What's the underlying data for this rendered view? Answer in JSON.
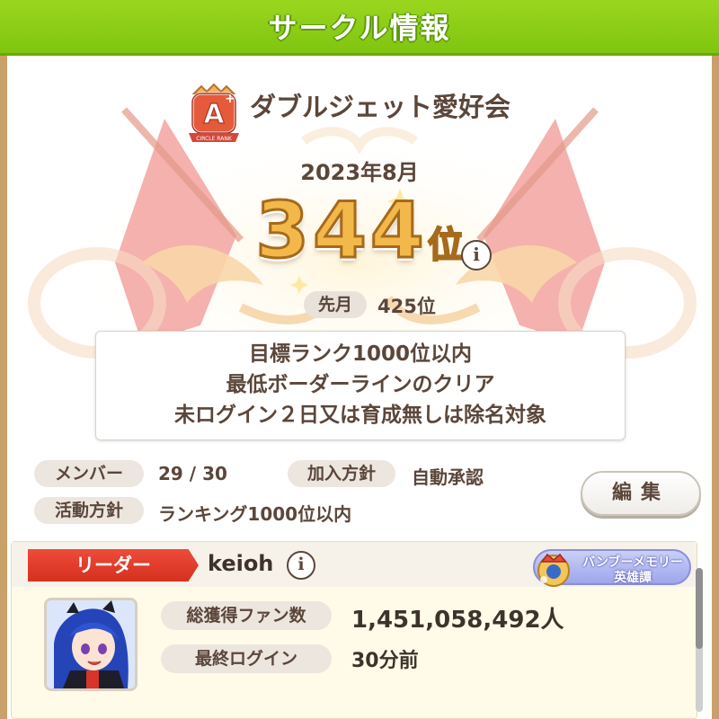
{
  "header": {
    "title": "サークル情報"
  },
  "circle": {
    "rank_badge_letter": "A",
    "rank_badge_text": "CIRCLE RANK",
    "name": "ダブルジェット愛好会",
    "period": "2023年8月",
    "rank_number": "344",
    "rank_unit": "位",
    "last_month_label": "先月",
    "last_month_value": "425位"
  },
  "goal": {
    "lines": [
      "目標ランク1000位以内",
      "最低ボーダーラインのクリア",
      "未ログイン２日又は育成無しは除名対象"
    ]
  },
  "info": {
    "members_label": "メンバー",
    "members_value": "29 / 30",
    "join_policy_label": "加入方針",
    "join_policy_value": "自動承認",
    "activity_label": "活動方針",
    "activity_value": "ランキング1000位以内",
    "edit_label": "編集"
  },
  "leader": {
    "tag": "リーダー",
    "name": "keioh",
    "title_line1": "バンブーメモリー",
    "title_line2": "英雄譚",
    "fans_label": "総獲得ファン数",
    "fans_value": "1,451,058,492人",
    "login_label": "最終ログイン",
    "login_value": "30分前"
  },
  "colors": {
    "header_green": "#8ccf16",
    "text_brown": "#5b463a",
    "rank_gold": "#f2b94a",
    "leader_red": "#e23f2e"
  },
  "icons": {
    "info": "info-icon",
    "rank_badge": "circle-rank-a-badge",
    "title_badge": "title-crown-icon"
  }
}
